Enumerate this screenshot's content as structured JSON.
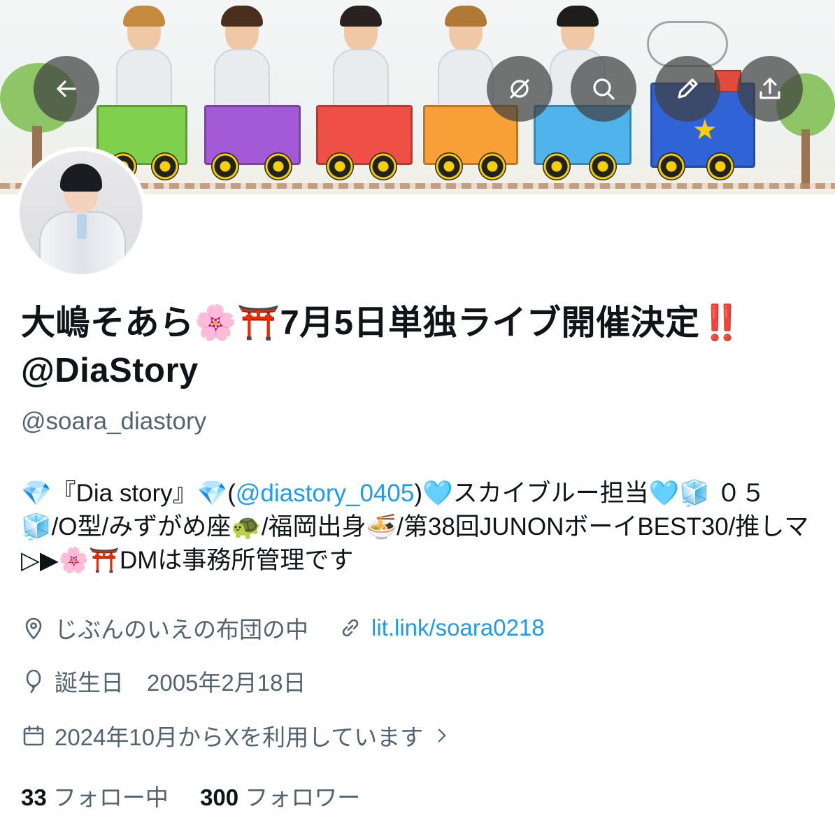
{
  "profile": {
    "display_name": "大嶋そあら🌸⛩️7月5日単独ライブ開催決定‼️@DiaStory",
    "handle": "@soara_diastory",
    "bio": {
      "part1": "💎『Dia story』💎(",
      "mention": "@diastory_0405",
      "part2": ")🩵スカイブルー担当🩵🧊 ０５ 🧊/O型/みずがめ座🐢/福岡出身🍜/第38回JUNONボーイBEST30/推しマ▷▶︎🌸⛩️DMは事務所管理です"
    },
    "location": "じぶんのいえの布団の中",
    "website": "lit.link/soara0218",
    "birthday": "誕生日　2005年2月18日",
    "joined": "2024年10月からXを利用しています",
    "following_count": "33",
    "following_label": "フォロー中",
    "followers_count": "300",
    "followers_label": "フォロワー"
  },
  "icons": {
    "back": "arrow-left-icon",
    "grok": "grok-icon",
    "search": "search-icon",
    "edit": "pencil-icon",
    "share": "share-icon",
    "location": "map-pin-icon",
    "link": "link-icon",
    "birthday": "balloon-icon",
    "joined": "calendar-icon",
    "chevron": "chevron-right-icon"
  },
  "colors": {
    "accent": "#1d9bf0",
    "secondary_text": "#536471",
    "primary_text": "#0f1419"
  }
}
